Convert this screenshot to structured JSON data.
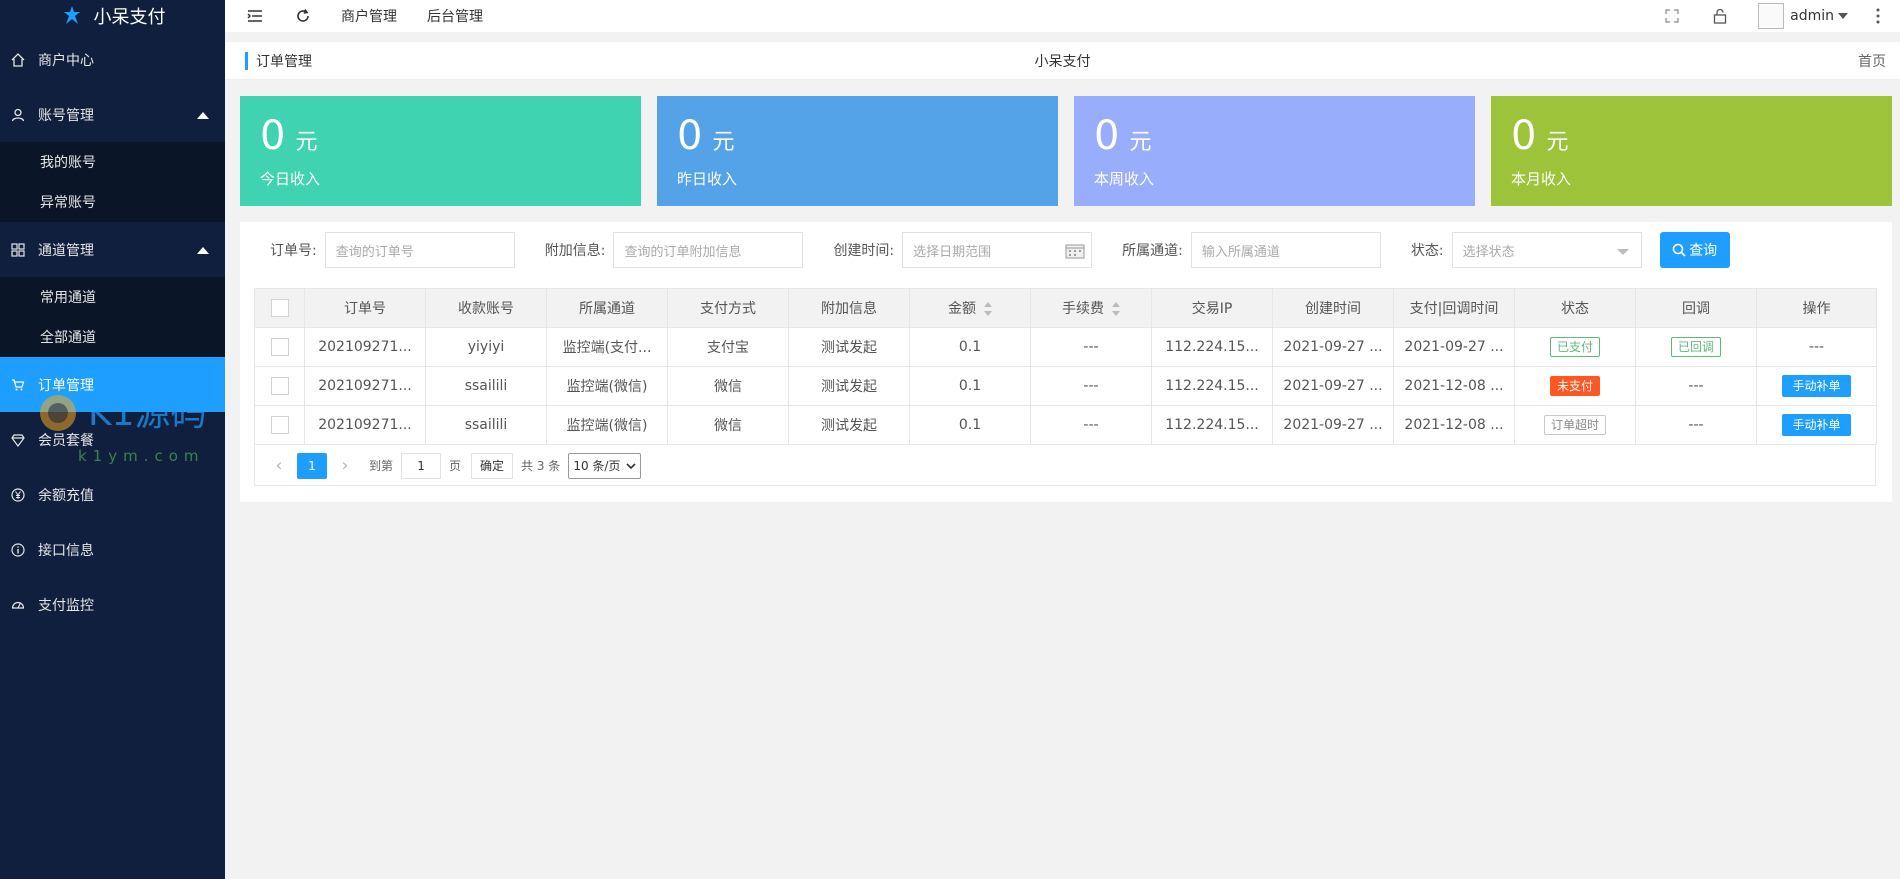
{
  "brand": {
    "name": "小呆支付"
  },
  "sidebar": {
    "items": [
      {
        "label": "商户中心",
        "icon": "home-icon"
      },
      {
        "label": "账号管理",
        "icon": "user-icon",
        "children": [
          "我的账号",
          "异常账号"
        ]
      },
      {
        "label": "通道管理",
        "icon": "grid-icon",
        "children": [
          "常用通道",
          "全部通道"
        ]
      },
      {
        "label": "订单管理",
        "icon": "cart-icon",
        "active": true
      },
      {
        "label": "会员套餐",
        "icon": "diamond-icon"
      },
      {
        "label": "余额充值",
        "icon": "yen-icon"
      },
      {
        "label": "接口信息",
        "icon": "info-icon"
      },
      {
        "label": "支付监控",
        "icon": "dashboard-icon"
      }
    ]
  },
  "topbar": {
    "links": [
      "商户管理",
      "后台管理"
    ],
    "user": "admin"
  },
  "breadcrumb": {
    "current": "订单管理",
    "center": "小呆支付",
    "home": "首页"
  },
  "stats": [
    {
      "value": "0",
      "unit": "元",
      "label": "今日收入",
      "color": "#40d3b2"
    },
    {
      "value": "0",
      "unit": "元",
      "label": "昨日收入",
      "color": "#54a3e8"
    },
    {
      "value": "0",
      "unit": "元",
      "label": "本周收入",
      "color": "#98aefc"
    },
    {
      "value": "0",
      "unit": "元",
      "label": "本月收入",
      "color": "#9cc33a"
    }
  ],
  "filters": {
    "order_no": {
      "label": "订单号:",
      "placeholder": "查询的订单号"
    },
    "extra": {
      "label": "附加信息:",
      "placeholder": "查询的订单附加信息"
    },
    "created": {
      "label": "创建时间:",
      "placeholder": "选择日期范围"
    },
    "channel": {
      "label": "所属通道:",
      "placeholder": "输入所属通道"
    },
    "status": {
      "label": "状态:",
      "placeholder": "选择状态"
    },
    "query_label": "查询"
  },
  "table": {
    "columns": [
      "订单号",
      "收款账号",
      "所属通道",
      "支付方式",
      "附加信息",
      "金额",
      "手续费",
      "交易IP",
      "创建时间",
      "支付|回调时间",
      "状态",
      "回调",
      "操作"
    ],
    "rows": [
      {
        "order": "202109271...",
        "account": "yiyiyi",
        "channel": "监控端(支付...",
        "method": "支付宝",
        "extra": "测试发起",
        "amount": "0.1",
        "fee": "---",
        "ip": "112.224.15...",
        "created": "2021-09-27 ...",
        "paid": "2021-09-27 ...",
        "status": "已支付",
        "status_type": "green",
        "callback": "已回调",
        "callback_type": "green",
        "action": "---"
      },
      {
        "order": "202109271...",
        "account": "ssailili",
        "channel": "监控端(微信)",
        "method": "微信",
        "extra": "测试发起",
        "amount": "0.1",
        "fee": "---",
        "ip": "112.224.15...",
        "created": "2021-09-27 ...",
        "paid": "2021-12-08 ...",
        "status": "未支付",
        "status_type": "red",
        "callback": "---",
        "callback_type": "",
        "action": "手动补单"
      },
      {
        "order": "202109271...",
        "account": "ssailili",
        "channel": "监控端(微信)",
        "method": "微信",
        "extra": "测试发起",
        "amount": "0.1",
        "fee": "---",
        "ip": "112.224.15...",
        "created": "2021-09-27 ...",
        "paid": "2021-12-08 ...",
        "status": "订单超时",
        "status_type": "gray",
        "callback": "---",
        "callback_type": "",
        "action": "手动补单"
      }
    ]
  },
  "pager": {
    "prev": "‹",
    "current": "1",
    "next": "›",
    "goto_label": "到第",
    "goto_value": "1",
    "page_unit": "页",
    "ok_label": "确定",
    "total": "共 3 条",
    "per_page": "10 条/页"
  },
  "watermark": {
    "text_cn": "K1源码",
    "text_url": "k1ym.com"
  }
}
